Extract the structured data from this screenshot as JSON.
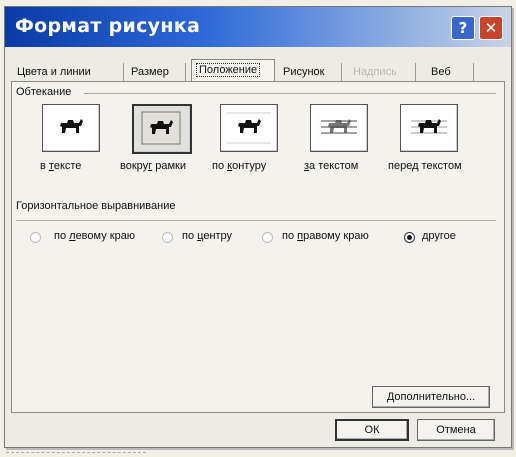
{
  "window": {
    "title": "Формат рисунка",
    "help_label": "?",
    "close_label": "✕"
  },
  "tabs": [
    {
      "label": "Цвета и линии",
      "state": "normal"
    },
    {
      "label": "Размер",
      "state": "normal"
    },
    {
      "label": "Положение",
      "state": "active"
    },
    {
      "label": "Рисунок",
      "state": "normal"
    },
    {
      "label": "Надпись",
      "state": "disabled"
    },
    {
      "label": "Веб",
      "state": "normal"
    }
  ],
  "wrapping": {
    "heading": "Обтекание",
    "options": [
      {
        "pre": "в ",
        "mnemonic": "т",
        "post": "ексте",
        "icon": "dog-inline-icon"
      },
      {
        "pre": "вокру",
        "mnemonic": "г",
        "post": " рамки",
        "icon": "dog-square-icon",
        "selected": true
      },
      {
        "pre": "по ",
        "mnemonic": "к",
        "post": "онтуру",
        "icon": "dog-tight-icon"
      },
      {
        "pre": "",
        "mnemonic": "з",
        "post": "а текстом",
        "icon": "dog-behind-icon"
      },
      {
        "pre": "пере",
        "mnemonic": "д",
        "post": " текстом",
        "icon": "dog-front-icon"
      }
    ]
  },
  "alignment": {
    "heading": "Горизонтальное выравнивание",
    "options": [
      {
        "pre": "по ",
        "mnemonic": "л",
        "post": "евому краю",
        "checked": false
      },
      {
        "pre": "по ",
        "mnemonic": "ц",
        "post": "ентру",
        "checked": false
      },
      {
        "pre": "по ",
        "mnemonic": "п",
        "post": "равому краю",
        "checked": false
      },
      {
        "pre": "",
        "mnemonic": "д",
        "post": "ругое",
        "checked": true
      }
    ]
  },
  "buttons": {
    "advanced": "Дополнительно...",
    "ok": "ОК",
    "cancel": "Отмена"
  },
  "colors": {
    "title_start": "#0a3aa6",
    "title_end": "#c9d3e6",
    "close": "#c7452d",
    "face": "#ecebe4"
  }
}
